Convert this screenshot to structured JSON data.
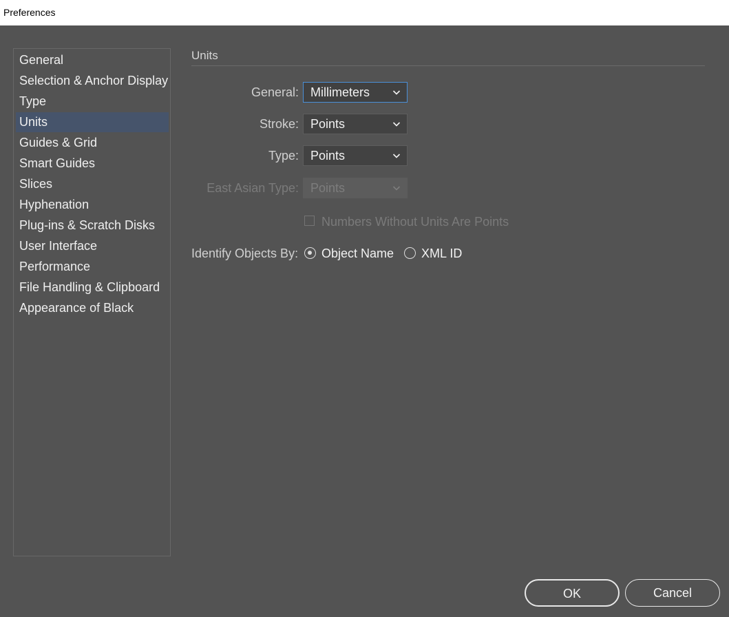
{
  "window": {
    "title": "Preferences"
  },
  "sidebar": {
    "items": [
      {
        "label": "General"
      },
      {
        "label": "Selection & Anchor Display"
      },
      {
        "label": "Type"
      },
      {
        "label": "Units",
        "selected": true
      },
      {
        "label": "Guides & Grid"
      },
      {
        "label": "Smart Guides"
      },
      {
        "label": "Slices"
      },
      {
        "label": "Hyphenation"
      },
      {
        "label": "Plug-ins & Scratch Disks"
      },
      {
        "label": "User Interface"
      },
      {
        "label": "Performance"
      },
      {
        "label": "File Handling & Clipboard"
      },
      {
        "label": "Appearance of Black"
      }
    ],
    "selected_color": "#46546b"
  },
  "units": {
    "section_title": "Units",
    "general": {
      "label": "General:",
      "value": "Millimeters"
    },
    "stroke": {
      "label": "Stroke:",
      "value": "Points"
    },
    "type": {
      "label": "Type:",
      "value": "Points"
    },
    "east_asian_type": {
      "label": "East Asian Type:",
      "value": "Points",
      "disabled": true
    },
    "numbers_without_units": {
      "label": "Numbers Without Units Are Points",
      "checked": false,
      "disabled": true
    },
    "identify_objects": {
      "label": "Identify Objects By:",
      "options": [
        {
          "label": "Object Name",
          "selected": true
        },
        {
          "label": "XML ID",
          "selected": false
        }
      ]
    }
  },
  "buttons": {
    "ok_label": "OK",
    "cancel_label": "Cancel"
  },
  "icons": {
    "dropdown": "chevron-down-icon"
  },
  "colors": {
    "background": "#535353",
    "focus_border": "#4a90d9"
  }
}
